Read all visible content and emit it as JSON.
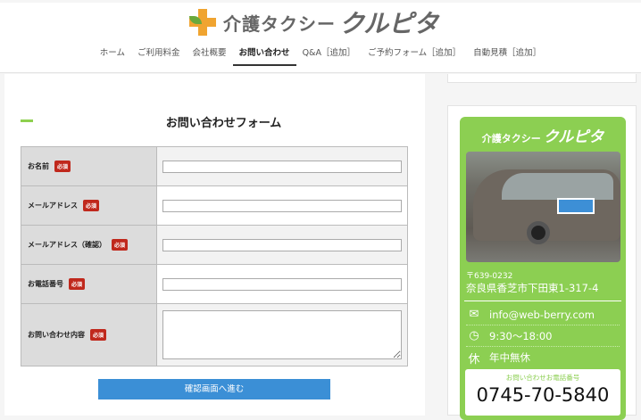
{
  "header": {
    "logo_text": "介護タクシー",
    "logo_brand": "クルピタ",
    "nav": [
      {
        "label": "ホーム"
      },
      {
        "label": "ご利用料金"
      },
      {
        "label": "会社概要"
      },
      {
        "label": "お問い合わせ",
        "active": true
      },
      {
        "label": "Q&A［追加］"
      },
      {
        "label": "ご予約フォーム［追加］"
      },
      {
        "label": "自動見積［追加］"
      }
    ]
  },
  "form": {
    "title": "お問い合わせフォーム",
    "required_label": "必須",
    "fields": [
      {
        "label": "お名前",
        "type": "text",
        "value": ""
      },
      {
        "label": "メールアドレス",
        "type": "text",
        "value": ""
      },
      {
        "label": "メールアドレス（確認）",
        "type": "text",
        "value": ""
      },
      {
        "label": "お電話番号",
        "type": "text",
        "value": ""
      },
      {
        "label": "お問い合わせ内容",
        "type": "textarea",
        "value": ""
      }
    ],
    "submit_label": "確認画面へ進む"
  },
  "sidebar": {
    "title_a": "介護タクシー",
    "title_b": "クルピタ",
    "zip": "〒639-0232",
    "address": "奈良県香芝市下田東1-317-4",
    "email": "info@web-berry.com",
    "hours": "9:30〜18:00",
    "holiday_icon": "休",
    "holiday": "年中無休",
    "tel_label": "お問い合わせお電話番号",
    "tel": "0745-70-5840"
  },
  "colors": {
    "accent_green": "#8ccf52",
    "required_red": "#c0281c",
    "button_blue": "#3b8fd6"
  }
}
